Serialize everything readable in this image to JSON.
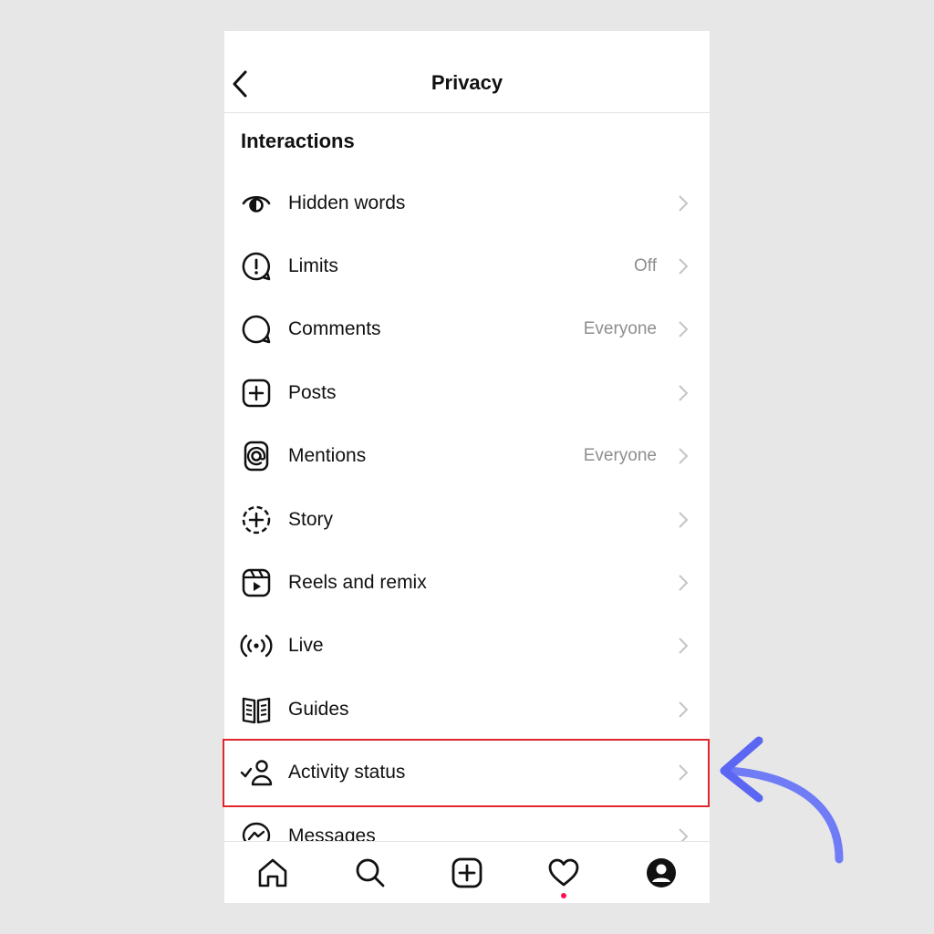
{
  "header": {
    "title": "Privacy"
  },
  "section": {
    "title": "Interactions"
  },
  "items": [
    {
      "label": "Hidden words",
      "value": "",
      "icon": "hidden-words-icon"
    },
    {
      "label": "Limits",
      "value": "Off",
      "icon": "limits-icon"
    },
    {
      "label": "Comments",
      "value": "Everyone",
      "icon": "comment-icon"
    },
    {
      "label": "Posts",
      "value": "",
      "icon": "plus-square-icon"
    },
    {
      "label": "Mentions",
      "value": "Everyone",
      "icon": "at-sign-icon"
    },
    {
      "label": "Story",
      "value": "",
      "icon": "story-add-icon"
    },
    {
      "label": "Reels and remix",
      "value": "",
      "icon": "reels-icon"
    },
    {
      "label": "Live",
      "value": "",
      "icon": "live-broadcast-icon"
    },
    {
      "label": "Guides",
      "value": "",
      "icon": "guides-book-icon"
    },
    {
      "label": "Activity status",
      "value": "",
      "icon": "activity-status-icon"
    },
    {
      "label": "Messages",
      "value": "",
      "icon": "messenger-icon"
    }
  ],
  "nav": [
    "home-icon",
    "search-icon",
    "create-icon",
    "activity-heart-icon",
    "profile-icon"
  ],
  "colors": {
    "highlight": "#e0262d",
    "arrow": "#6f7cf6",
    "notification": "#ff0f54",
    "secondary_text": "#8e8e8e"
  }
}
